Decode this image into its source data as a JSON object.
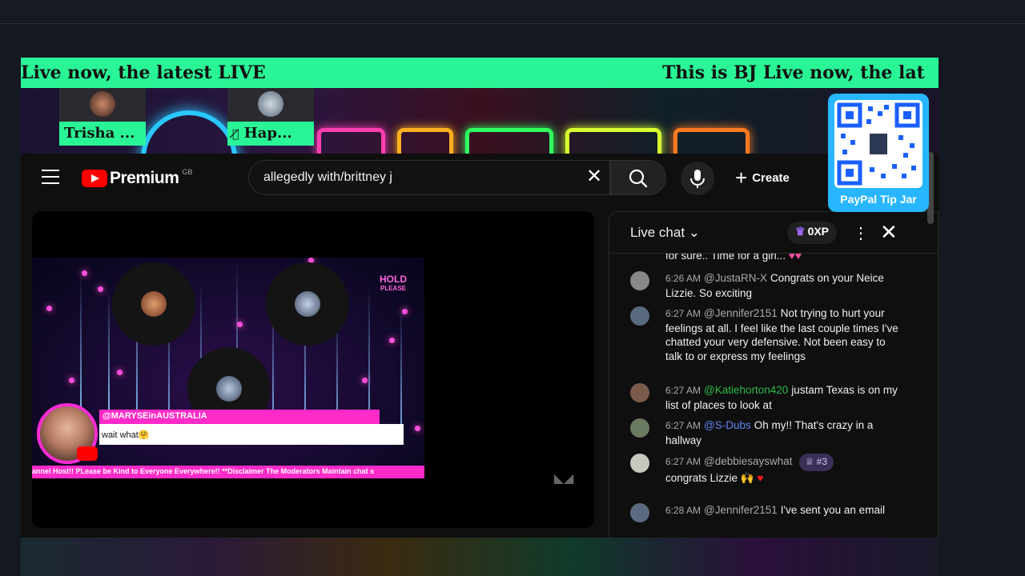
{
  "ticker": {
    "text_a": "Live now, the latest LIVE",
    "text_b": "This is BJ Live now, the lat"
  },
  "guests": [
    {
      "label": "Trisha ..."
    },
    {
      "label": "Hap..."
    }
  ],
  "youtube": {
    "brand": "Premium",
    "country_code": "GB",
    "search_query": "allegedly with/brittney j",
    "create_label": "Create"
  },
  "qr": {
    "label": "PayPal Tip Jar"
  },
  "player": {
    "hold_line1": "HOLD",
    "hold_line2": "PLEASE",
    "commenter": "@MARYSEinAUSTRALIA",
    "comment": "wait what🤗",
    "crawl": "annel Host!! PLease be Kind to Everyone Everywhere!! **Disclaimer The Moderators Maintain chat s"
  },
  "chat": {
    "title": "Live chat",
    "xp": "0XP",
    "partial_top": "for sure.. Time for a girl...",
    "messages": [
      {
        "time": "6:26 AM",
        "author": "@JustaRN-X",
        "text": "Congrats on your Neice Lizzie. So exciting"
      },
      {
        "time": "6:27 AM",
        "author": "@Jennifer2151",
        "text": "Not trying to hurt your feelings at all. I feel like the last couple times I've chatted your very defensive. Not been easy to talk to or express my feelings"
      },
      {
        "time": "6:27 AM",
        "author": "@Katiehorton420",
        "text": "justam Texas is on my list of places to look at"
      },
      {
        "time": "6:27 AM",
        "author": "@S-Dubs",
        "text": "Oh my!! That's crazy in a hallway"
      },
      {
        "time": "6:27 AM",
        "author": "@debbiesayswhat",
        "badge": "#3",
        "text": "congrats Lizzie 🙌"
      },
      {
        "time": "6:28 AM",
        "author": "@Jennifer2151",
        "text": "I've sent you an email"
      }
    ]
  },
  "colors": {
    "ticker": "#2af596",
    "qr_bg": "#27b6ff",
    "host_pink": "#ff2bc8",
    "yt_red": "#ff0000"
  }
}
